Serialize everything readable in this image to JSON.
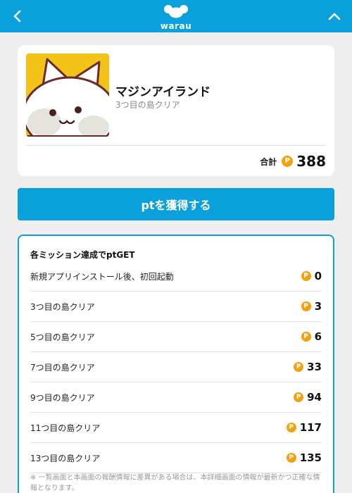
{
  "header": {
    "logo_text": "warau",
    "back_icon": "chevron-left-icon",
    "collapse_icon": "chevron-up-icon",
    "color": "#0aa0dc"
  },
  "app": {
    "name": "マジンアイランド",
    "subtitle": "3つ目の島クリア",
    "total_label": "合計",
    "total_points": "388",
    "point_icon": "P"
  },
  "cta": {
    "label": "ptを獲得する"
  },
  "missions": {
    "title": "各ミッション達成でptGET",
    "items": [
      {
        "label": "新規アプリインストール後、初回起動",
        "points": "0"
      },
      {
        "label": "3つ目の島クリア",
        "points": "3"
      },
      {
        "label": "5つ目の島クリア",
        "points": "6"
      },
      {
        "label": "7つ目の島クリア",
        "points": "33"
      },
      {
        "label": "9つ目の島クリア",
        "points": "94"
      },
      {
        "label": "11つ目の島クリア",
        "points": "117"
      },
      {
        "label": "13つ目の島クリア",
        "points": "135"
      }
    ],
    "note": "※ 一覧画面と本画面の報酬情報に差異がある場合は、本詳細画面の情報が最新かつ正確な情報となります。"
  },
  "colors": {
    "accent": "#0aa0dc",
    "coin": "#f2a20f",
    "icon_bg": "#f3c318"
  }
}
